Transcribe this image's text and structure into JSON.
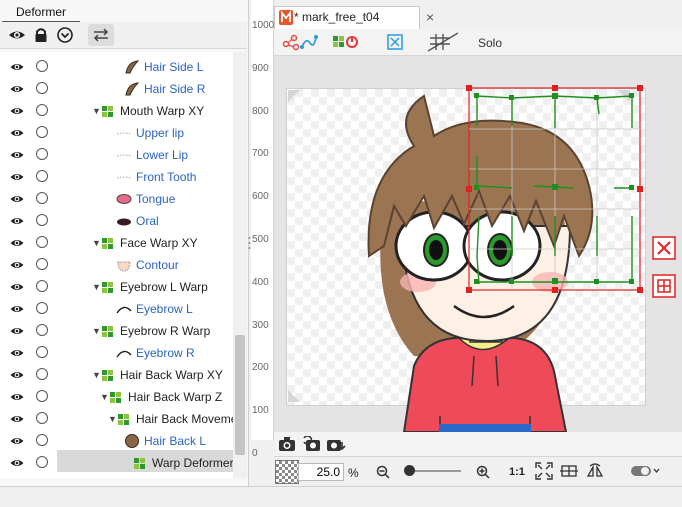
{
  "panel": {
    "tab_label": "Deformer"
  },
  "tree": {
    "rows": [
      {
        "label": "Hair Side L",
        "blue": true
      },
      {
        "label": "Hair Side R",
        "blue": true
      },
      {
        "label": "Mouth Warp XY",
        "blue": false
      },
      {
        "label": "Upper lip",
        "blue": true
      },
      {
        "label": "Lower Lip",
        "blue": true
      },
      {
        "label": "Front Tooth",
        "blue": true
      },
      {
        "label": "Tongue",
        "blue": true
      },
      {
        "label": "Oral",
        "blue": true
      },
      {
        "label": "Face Warp XY",
        "blue": false
      },
      {
        "label": "Contour",
        "blue": true
      },
      {
        "label": "Eyebrow L Warp",
        "blue": false
      },
      {
        "label": "Eyebrow L",
        "blue": true
      },
      {
        "label": "Eyebrow R Warp",
        "blue": false
      },
      {
        "label": "Eyebrow R",
        "blue": true
      },
      {
        "label": "Hair Back Warp    XY",
        "blue": false
      },
      {
        "label": "Hair Back Warp    Z",
        "blue": false
      },
      {
        "label": "Hair Back Moveme",
        "blue": false
      },
      {
        "label": "Hair Back L",
        "blue": true
      },
      {
        "label": "Warp Deformer",
        "blue": false
      }
    ]
  },
  "document": {
    "tab_title": "* mark_free_t04",
    "close_glyph": "×"
  },
  "view_toolbar": {
    "solo_label": "Solo"
  },
  "ruler": {
    "ticks": [
      "1000",
      "900",
      "800",
      "700",
      "600",
      "500",
      "400",
      "300",
      "200",
      "100",
      "0"
    ]
  },
  "zoom": {
    "value": "25.0",
    "unit": "%",
    "ratio_label": "1:1"
  },
  "colors": {
    "blue_text": "#2a63c4",
    "deformer_green": "#1f8f1f",
    "bbox_red": "#e02020",
    "hoodie": "#ef4a5a",
    "hair": "#9b7552"
  },
  "icons": {
    "eye": "eye-icon",
    "lock": "lock-icon",
    "warp": "warp-deformer-icon",
    "delete": "delete-deformer-icon",
    "grid": "grid-icon"
  }
}
